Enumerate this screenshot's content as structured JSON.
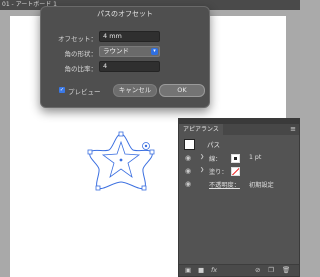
{
  "document": {
    "tab_title": "01 - アートボード 1"
  },
  "dialog": {
    "title": "パスのオフセット",
    "offset_label": "オフセット：",
    "offset_value": "4 mm",
    "joins_label": "角の形状：",
    "joins_value": "ラウンド",
    "miter_label": "角の比率：",
    "miter_value": "4",
    "preview_label": "プレビュー",
    "preview_checked": true,
    "cancel_label": "キャンセル",
    "ok_label": "OK"
  },
  "appearance": {
    "tab_label": "アピアランス",
    "object_label": "パス",
    "stroke_label": "線：",
    "stroke_value": "1 pt",
    "fill_label": "塗り：",
    "opacity_label": "不透明度：",
    "opacity_value": "初期設定"
  },
  "colors": {
    "selection": "#3b6fe0",
    "dialog_bg": "#4f4f4f",
    "panel_bg": "#535353"
  },
  "icons": [
    "eye-icon",
    "chevron-right-icon",
    "panel-menu-icon",
    "new-layer-icon",
    "fx-icon",
    "delete-icon"
  ]
}
